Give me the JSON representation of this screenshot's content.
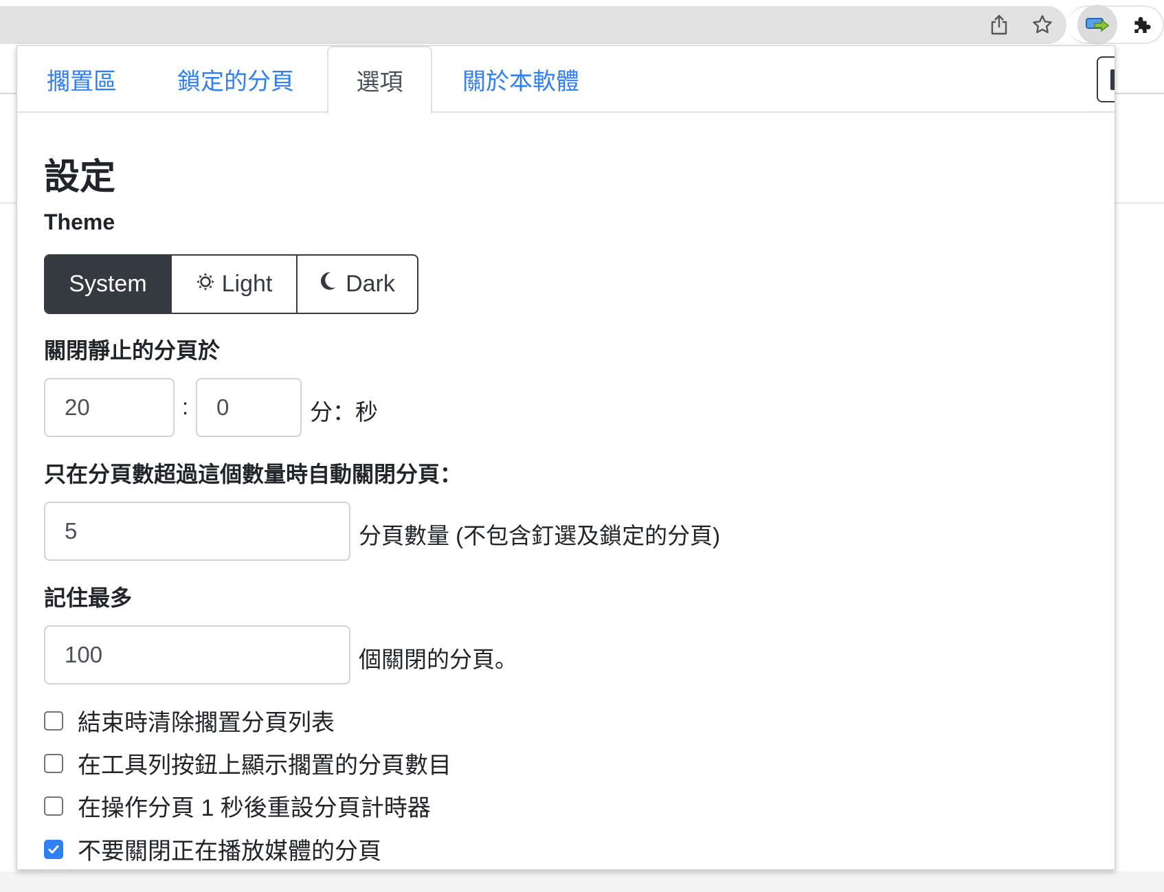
{
  "browser": {
    "icons": [
      "share-icon",
      "star-icon",
      "extension-tab-icon",
      "puzzle-icon"
    ]
  },
  "tabs": [
    {
      "label": "擱置區",
      "active": false
    },
    {
      "label": "鎖定的分頁",
      "active": false
    },
    {
      "label": "選項",
      "active": true
    },
    {
      "label": "關於本軟體",
      "active": false
    }
  ],
  "settings": {
    "title": "設定",
    "theme": {
      "label": "Theme",
      "options": [
        {
          "label": "System",
          "icon": "",
          "selected": true
        },
        {
          "label": "Light",
          "icon": "sun-icon",
          "selected": false
        },
        {
          "label": "Dark",
          "icon": "moon-icon",
          "selected": false
        }
      ]
    },
    "idle": {
      "label": "關閉靜止的分頁於",
      "minutes": "20",
      "separator": ":",
      "seconds": "0",
      "suffix": "分：秒"
    },
    "min_tabs": {
      "label": "只在分頁數超過這個數量時自動關閉分頁：",
      "value": "5",
      "suffix": "分頁數量 (不包含釘選及鎖定的分頁)"
    },
    "remember": {
      "label": "記住最多",
      "value": "100",
      "suffix": "個關閉的分頁。"
    },
    "checkboxes": [
      {
        "label": "結束時清除擱置分頁列表",
        "checked": false
      },
      {
        "label": "在工具列按鈕上顯示擱置的分頁數目",
        "checked": false
      },
      {
        "label": "在操作分頁 1 秒後重設分頁計時器",
        "checked": false
      },
      {
        "label": "不要關閉正在播放媒體的分頁",
        "checked": true
      }
    ]
  },
  "colors": {
    "accent": "#2f7ff5",
    "dark": "#343a40"
  }
}
